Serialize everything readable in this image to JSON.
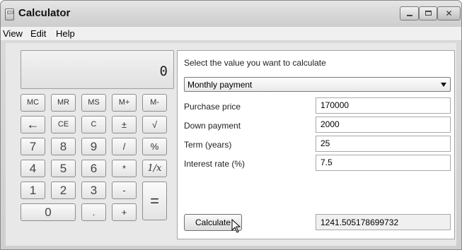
{
  "window": {
    "title": "Calculator",
    "minimize_glyph": "",
    "maximize_glyph": "",
    "close_glyph": "✕"
  },
  "menu": {
    "items": [
      "View",
      "Edit",
      "Help"
    ]
  },
  "display": {
    "value": "0"
  },
  "keys": {
    "row1": [
      "MC",
      "MR",
      "MS",
      "M+",
      "M-"
    ],
    "row2": [
      "←",
      "CE",
      "C",
      "±",
      "√"
    ],
    "row3": [
      "7",
      "8",
      "9",
      "/",
      "%"
    ],
    "row4": [
      "4",
      "5",
      "6",
      "*",
      "1/x"
    ],
    "row5": [
      "1",
      "2",
      "3",
      "-"
    ],
    "row6": [
      "0",
      ".",
      "+"
    ],
    "equals": "="
  },
  "mortgage": {
    "prompt": "Select the value you want to calculate",
    "selected_option": "Monthly payment",
    "fields": [
      {
        "label": "Purchase price",
        "value": "170000"
      },
      {
        "label": "Down payment",
        "value": "2000"
      },
      {
        "label": "Term (years)",
        "value": "25"
      },
      {
        "label": "Interest rate (%)",
        "value": "7.5"
      }
    ],
    "calculate_label": "Calculate",
    "result": "1241.505178699732"
  }
}
